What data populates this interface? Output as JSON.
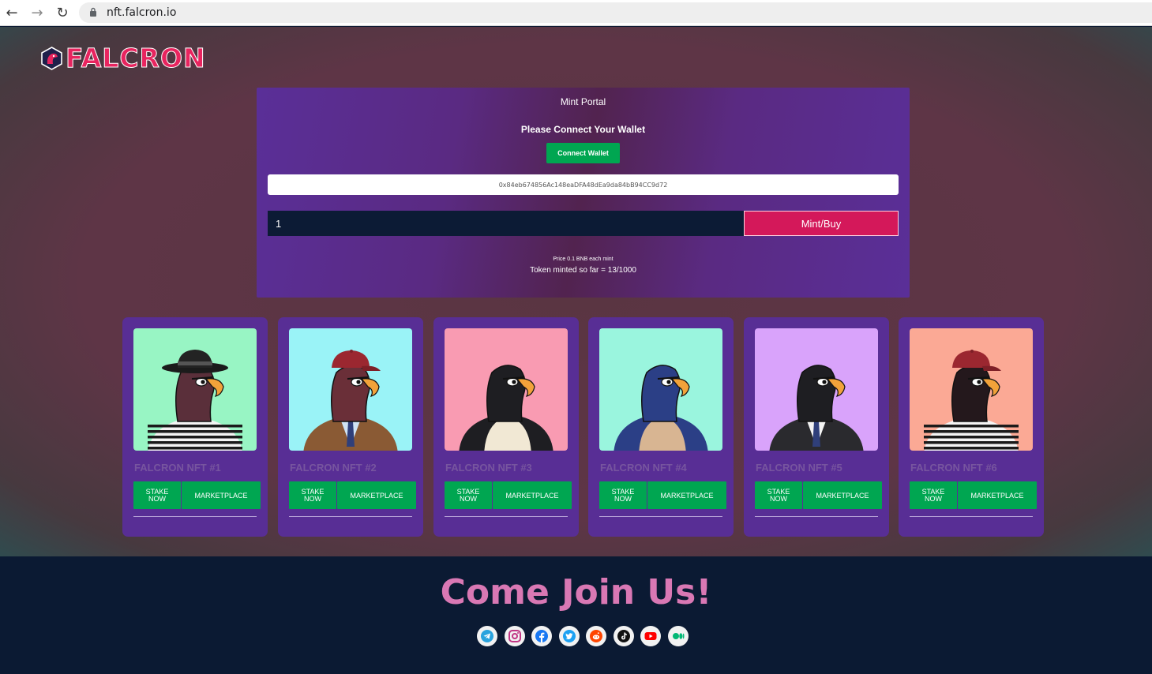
{
  "browser": {
    "url": "nft.falcron.io"
  },
  "brand": {
    "name": "FALCRON"
  },
  "mint": {
    "title": "Mint Portal",
    "prompt": "Please Connect Your Wallet",
    "connect_label": "Connect Wallet",
    "contract_address": "0x84eb674856Ac148eaDFA48dEa9da84bB94CC9d72",
    "quantity": "1",
    "mint_label": "Mint/Buy",
    "price_text": "Price 0.1 BNB each mint",
    "minted_text": "Token minted so far = 13/1000"
  },
  "cards": [
    {
      "title": "FALCRON NFT #1",
      "stake_line1": "STAKE",
      "stake_line2": "NOW",
      "market_label": "MARKETPLACE",
      "bg": "#98f5c4"
    },
    {
      "title": "FALCRON NFT #2",
      "stake_line1": "STAKE",
      "stake_line2": "NOW",
      "market_label": "MARKETPLACE",
      "bg": "#9af3f7"
    },
    {
      "title": "FALCRON NFT #3",
      "stake_line1": "STAKE",
      "stake_line2": "NOW",
      "market_label": "MARKETPLACE",
      "bg": "#f99bb2"
    },
    {
      "title": "FALCRON NFT #4",
      "stake_line1": "STAKE",
      "stake_line2": "NOW",
      "market_label": "MARKETPLACE",
      "bg": "#9af5de"
    },
    {
      "title": "FALCRON NFT #5",
      "stake_line1": "STAKE",
      "stake_line2": "NOW",
      "market_label": "MARKETPLACE",
      "bg": "#d9a3fb"
    },
    {
      "title": "FALCRON NFT #6",
      "stake_line1": "STAKE",
      "stake_line2": "NOW",
      "market_label": "MARKETPLACE",
      "bg": "#fba995"
    }
  ],
  "footer": {
    "title": "Come Join Us!",
    "socials": [
      "telegram-icon",
      "instagram-icon",
      "facebook-icon",
      "twitter-icon",
      "reddit-icon",
      "tiktok-icon",
      "youtube-icon",
      "medium-icon"
    ]
  },
  "colors": {
    "accent_green": "#00a651",
    "mint_pink": "#d4185a",
    "panel_purple": "#5a2f98",
    "join_pink": "#d978b4"
  }
}
